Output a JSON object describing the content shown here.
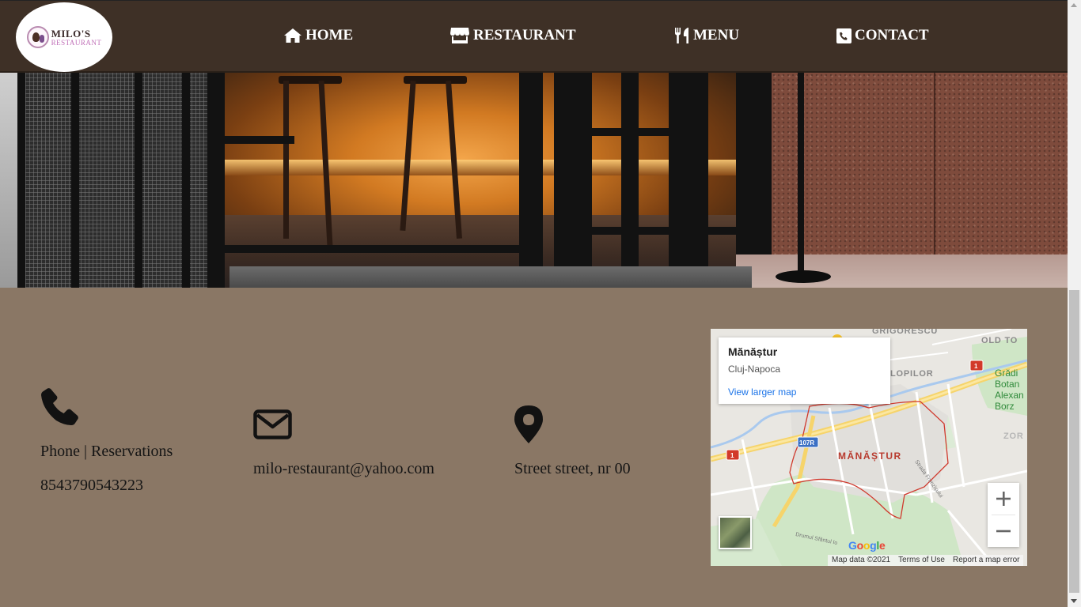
{
  "brand": {
    "line1": "MILO'S",
    "line2": "RESTAURANT",
    "logo_icon": "chef-emblem"
  },
  "nav": [
    {
      "label": "HOME",
      "icon": "home-icon"
    },
    {
      "label": "RESTAURANT",
      "icon": "store-icon"
    },
    {
      "label": "MENU",
      "icon": "utensils-icon"
    },
    {
      "label": "CONTACT",
      "icon": "phone-square-icon"
    }
  ],
  "hero": {
    "image": "restaurant-entrance-photo"
  },
  "contact": {
    "phone": {
      "icon": "phone-icon",
      "title": "Phone | Reservations",
      "number": "8543790543223"
    },
    "email": {
      "icon": "envelope-icon",
      "address": "milo-restaurant@yahoo.com"
    },
    "location": {
      "icon": "map-marker-icon",
      "address": "Street street, nr 00"
    }
  },
  "map": {
    "place_name": "Mănăștur",
    "place_city": "Cluj-Napoca",
    "larger_map_link": "View larger map",
    "area_label": "MĂNĂȘTUR",
    "labels": {
      "grigorescu": "GRIGORESCU",
      "old_town": "OLD TO",
      "lopilor": "LOPILOR",
      "zorilor": "ZOR",
      "garden": "Grădi\nBotan\nAlexan\nBorz",
      "road_107r": "107R",
      "road_1a": "1",
      "road_1b": "1",
      "street1": "Strada Frunzișului",
      "street2": "Drumul Sfântul Io"
    },
    "zoom_in": "+",
    "zoom_out": "−",
    "google": "Google",
    "attribution": [
      "Map data ©2021",
      "Terms of Use",
      "Report a map error"
    ]
  },
  "colors": {
    "header_bg": "#3e3026",
    "page_bg": "#8a7765",
    "text": "#151515",
    "map_area_red": "#d03a2e"
  }
}
